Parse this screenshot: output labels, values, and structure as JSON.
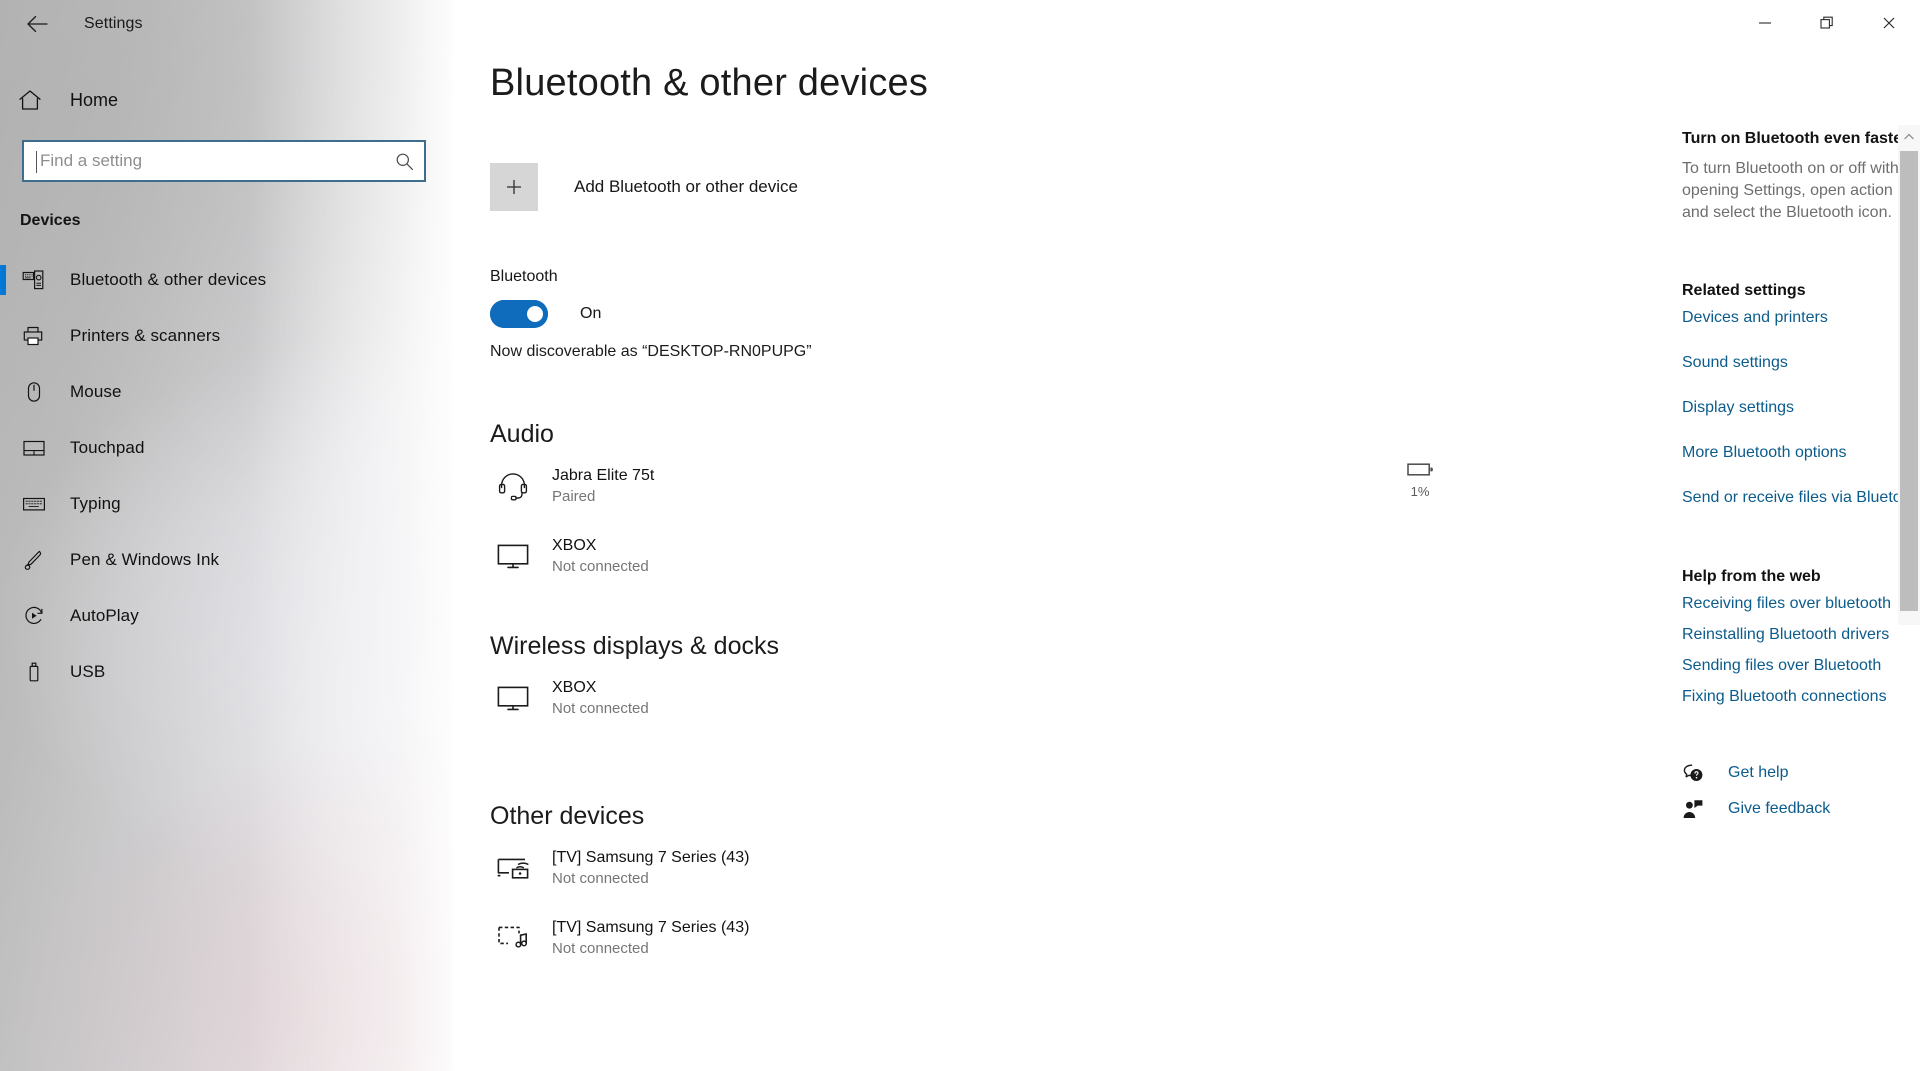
{
  "window": {
    "title": "Settings",
    "back_icon": "back-arrow-icon",
    "controls": {
      "minimize": "minimize-icon",
      "restore": "restore-icon",
      "close": "close-icon"
    }
  },
  "sidebar": {
    "home": {
      "label": "Home",
      "icon": "home-icon"
    },
    "search": {
      "value": "",
      "placeholder": "Find a setting",
      "icon": "search-icon"
    },
    "group_label": "Devices",
    "items": [
      {
        "label": "Bluetooth & other devices",
        "icon": "bluetooth-devices-icon",
        "selected": true
      },
      {
        "label": "Printers & scanners",
        "icon": "printer-icon",
        "selected": false
      },
      {
        "label": "Mouse",
        "icon": "mouse-icon",
        "selected": false
      },
      {
        "label": "Touchpad",
        "icon": "touchpad-icon",
        "selected": false
      },
      {
        "label": "Typing",
        "icon": "keyboard-icon",
        "selected": false
      },
      {
        "label": "Pen & Windows Ink",
        "icon": "pen-icon",
        "selected": false
      },
      {
        "label": "AutoPlay",
        "icon": "autoplay-icon",
        "selected": false
      },
      {
        "label": "USB",
        "icon": "usb-icon",
        "selected": false
      }
    ]
  },
  "main": {
    "page_title": "Bluetooth & other devices",
    "add_device": {
      "label": "Add Bluetooth or other device",
      "icon": "plus-icon"
    },
    "bluetooth": {
      "label": "Bluetooth",
      "state": "On",
      "discoverable": "Now discoverable as “DESKTOP-RN0PUPG”"
    },
    "sections": [
      {
        "title": "Audio",
        "devices": [
          {
            "name": "Jabra Elite 75t",
            "status": "Paired",
            "icon": "headset-icon",
            "battery": "1%"
          },
          {
            "name": "XBOX",
            "status": "Not connected",
            "icon": "monitor-icon",
            "battery": ""
          }
        ]
      },
      {
        "title": "Wireless displays & docks",
        "devices": [
          {
            "name": "XBOX",
            "status": "Not connected",
            "icon": "monitor-icon",
            "battery": ""
          }
        ]
      },
      {
        "title": "Other devices",
        "devices": [
          {
            "name": "[TV] Samsung 7 Series (43)",
            "status": "Not connected",
            "icon": "cast-display-icon",
            "battery": ""
          },
          {
            "name": "[TV] Samsung 7 Series (43)",
            "status": "Not connected",
            "icon": "media-display-icon",
            "battery": ""
          }
        ]
      }
    ]
  },
  "rail": {
    "tip_title": "Turn on Bluetooth even faster",
    "tip_body": "To turn Bluetooth on or off without opening Settings, open action center and select the Bluetooth icon.",
    "related_title": "Related settings",
    "related_links": [
      "Devices and printers",
      "Sound settings",
      "Display settings",
      "More Bluetooth options",
      "Send or receive files via Bluetooth"
    ],
    "help_title": "Help from the web",
    "help_links": [
      "Receiving files over bluetooth",
      "Reinstalling Bluetooth drivers",
      "Sending files over Bluetooth",
      "Fixing Bluetooth connections"
    ],
    "support": [
      {
        "label": "Get help",
        "icon": "get-help-icon"
      },
      {
        "label": "Give feedback",
        "icon": "give-feedback-icon"
      }
    ]
  },
  "colors": {
    "accent": "#0078d7",
    "toggle_on": "#0f6cbd",
    "link": "#0b5c8c",
    "muted_text": "#767676"
  }
}
